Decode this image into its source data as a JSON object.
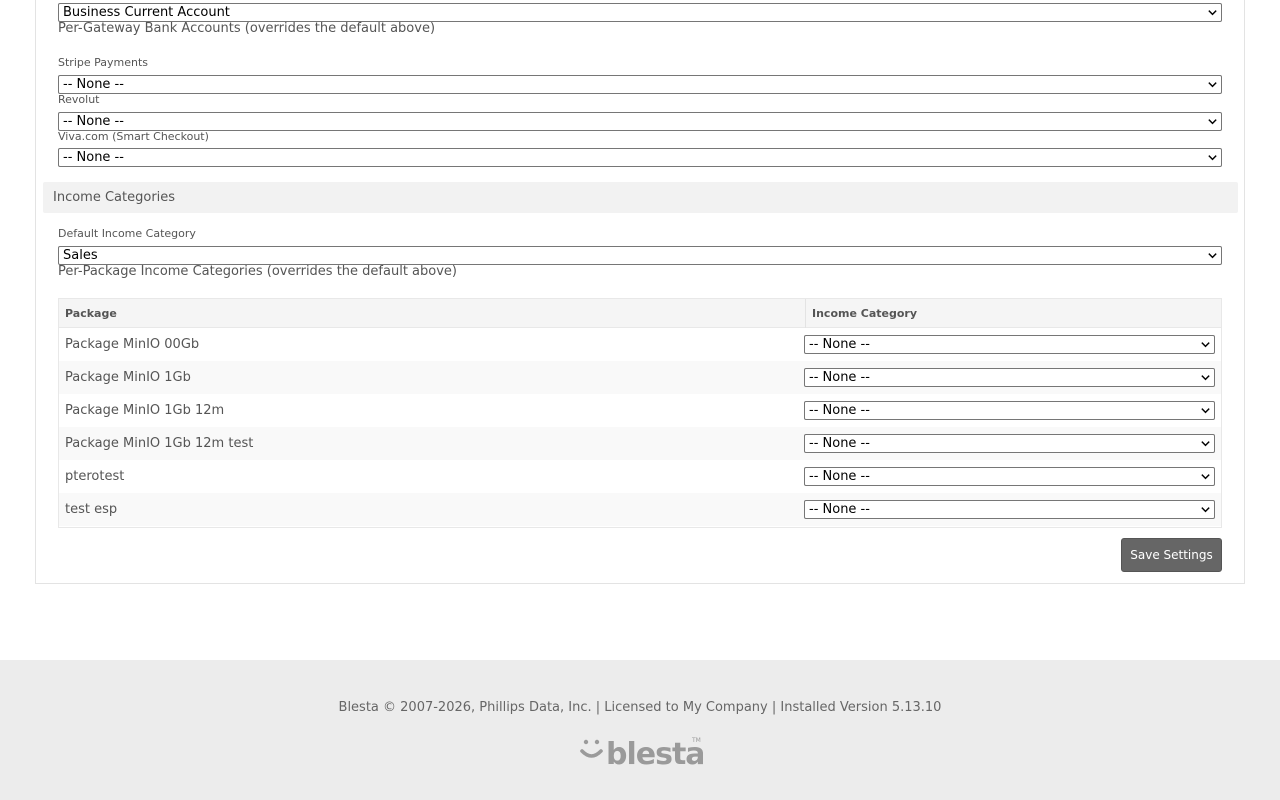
{
  "bank_accounts": {
    "default_value": "Business Current Account",
    "per_gateway_heading": "Per-Gateway Bank Accounts (overrides the default above)",
    "gateways": [
      {
        "label": "Stripe Payments",
        "value": "-- None --"
      },
      {
        "label": "Revolut",
        "value": "-- None --"
      },
      {
        "label": "Viva.com (Smart Checkout)",
        "value": "-- None --"
      }
    ]
  },
  "income_categories": {
    "section_title": "Income Categories",
    "default_label": "Default Income Category",
    "default_value": "Sales",
    "per_package_heading": "Per-Package Income Categories (overrides the default above)",
    "table": {
      "headers": [
        "Package",
        "Income Category"
      ],
      "rows": [
        {
          "package": "Package MinIO 00Gb",
          "category": "-- None --"
        },
        {
          "package": "Package MinIO 1Gb",
          "category": "-- None --"
        },
        {
          "package": "Package MinIO 1Gb 12m",
          "category": "-- None --"
        },
        {
          "package": "Package MinIO 1Gb 12m test",
          "category": "-- None --"
        },
        {
          "package": "pterotest",
          "category": "-- None --"
        },
        {
          "package": "test esp",
          "category": "-- None --"
        }
      ]
    }
  },
  "actions": {
    "save_label": "Save Settings"
  },
  "footer": {
    "text": "Blesta © 2007-2026, Phillips Data, Inc. | Licensed to My Company | Installed Version 5.13.10",
    "logo_text": "blesta",
    "logo_tm": "TM"
  },
  "colors": {
    "button": "#666666",
    "footer_bg": "#ececec",
    "section_bg": "#f2f2f2"
  },
  "icons": {
    "select_arrow": "chevron-down-icon",
    "logo": "blesta-logo-icon"
  }
}
